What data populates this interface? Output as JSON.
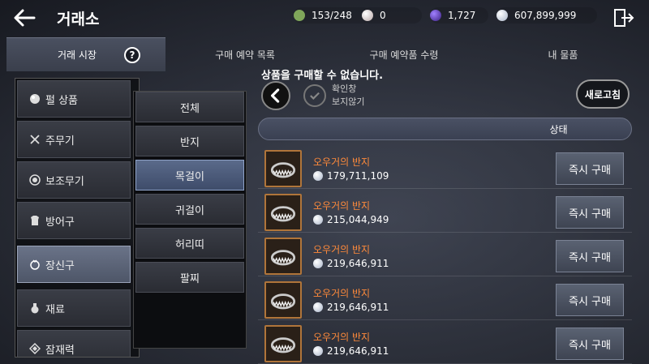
{
  "header": {
    "title": "거래소",
    "stats": [
      {
        "icon": "weight-icon",
        "value": "153/248",
        "color": "#7fa65a"
      },
      {
        "icon": "pearl-icon",
        "value": "0",
        "color": "#d8d0d0"
      },
      {
        "icon": "crystal-icon",
        "value": "1,727",
        "color": "#5a3ea8"
      },
      {
        "icon": "silver-icon",
        "value": "607,899,999",
        "color": "#c8d2e0"
      }
    ]
  },
  "tabs": [
    {
      "label": "거래 시장"
    },
    {
      "label": "구매 예약 목록"
    },
    {
      "label": "구매 예약품 수령"
    },
    {
      "label": "내 물품"
    }
  ],
  "help_label": "?",
  "categories": [
    {
      "label": "펄 상품",
      "icon": "pearl-icon"
    },
    {
      "label": "주무기",
      "icon": "crossed-swords-icon"
    },
    {
      "label": "보조무기",
      "icon": "ring-target-icon"
    },
    {
      "label": "방어구",
      "icon": "armor-icon"
    },
    {
      "label": "장신구",
      "icon": "accessory-icon"
    },
    {
      "label": "재료",
      "icon": "potion-icon"
    },
    {
      "label": "잠재력",
      "icon": "gem-icon"
    }
  ],
  "subcategories": [
    "전체",
    "반지",
    "목걸이",
    "귀걸이",
    "허리띠",
    "팔찌"
  ],
  "notice": "상품을 구매할 수 없습니다.",
  "hide_checked": [
    "확인창",
    "보지않기"
  ],
  "refresh_label": "새로고침",
  "status_header": "상태",
  "listings": [
    {
      "name": "오우거의 반지",
      "price": "179,711,109",
      "button": "즉시 구매"
    },
    {
      "name": "오우거의 반지",
      "price": "215,044,949",
      "button": "즉시 구매"
    },
    {
      "name": "오우거의 반지",
      "price": "219,646,911",
      "button": "즉시 구매"
    },
    {
      "name": "오우거의 반지",
      "price": "219,646,911",
      "button": "즉시 구매"
    },
    {
      "name": "오우거의 반지",
      "price": "219,646,911",
      "button": "즉시 구매"
    }
  ]
}
